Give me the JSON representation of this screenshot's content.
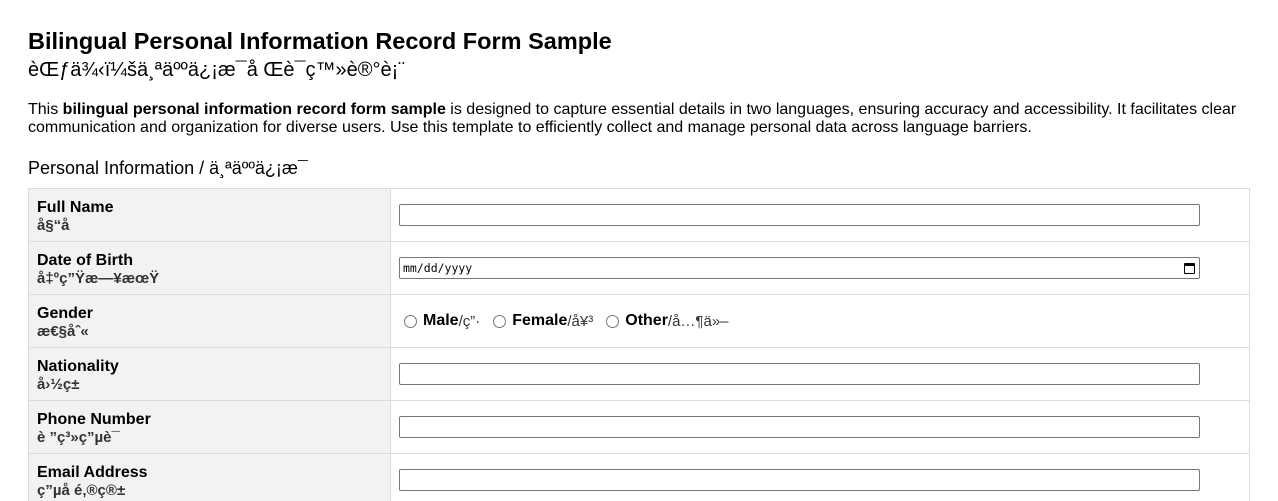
{
  "header": {
    "title": "Bilingual Personal Information Record Form Sample",
    "subtitle": "èŒƒä¾‹ï¼šä¸ªäººä¿¡æ¯å Œè¯­ç™»è®°è¡¨"
  },
  "intro": {
    "prefix": "This ",
    "bold": "bilingual personal information record form sample",
    "suffix": " is designed to capture essential details in two languages, ensuring accuracy and accessibility. It facilitates clear communication and organization for diverse users. Use this template to efficiently collect and manage personal data across language barriers."
  },
  "section": {
    "heading": "Personal Information / ä¸ªäººä¿¡æ¯"
  },
  "rows": [
    {
      "label_en": "Full Name",
      "label_zh": "å§“å ",
      "value": ""
    },
    {
      "label_en": "Date of Birth",
      "label_zh": "å‡ºç”Ÿæ—¥æœŸ",
      "placeholder": "mm/dd/yyyy"
    },
    {
      "label_en": "Gender",
      "label_zh": "æ€§åˆ«",
      "options": [
        {
          "en": "Male",
          "zh": "/ç”·"
        },
        {
          "en": "Female",
          "zh": "/å¥³"
        },
        {
          "en": "Other",
          "zh": "/å…¶ä»–"
        }
      ]
    },
    {
      "label_en": "Nationality",
      "label_zh": "å›½ç±",
      "value": ""
    },
    {
      "label_en": "Phone Number",
      "label_zh": "è ”ç³»ç”µè¯",
      "value": ""
    },
    {
      "label_en": "Email Address",
      "label_zh": "ç”µå é‚®ç®±",
      "value": ""
    }
  ],
  "colors": {
    "label_bg": "#f2f2f2",
    "border": "#dcdcdc",
    "input_border": "#767676"
  },
  "icons": {
    "date_picker": "calendar-icon"
  }
}
